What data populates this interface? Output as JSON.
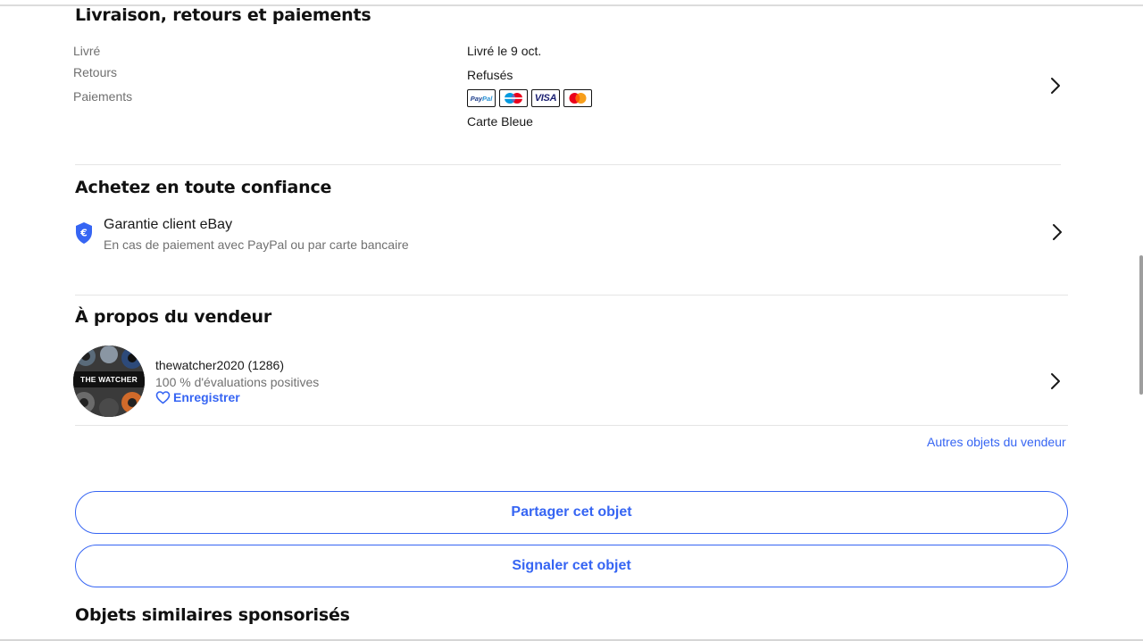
{
  "delivery_section": {
    "title": "Livraison, retours et paiements",
    "labels": {
      "delivered": "Livré",
      "returns": "Retours",
      "payments": "Paiements"
    },
    "values": {
      "delivered": "Livré le 9 oct.",
      "returns": "Refusés",
      "payment_note": "Carte Bleue"
    },
    "payment_methods": [
      {
        "name": "PayPal",
        "label_a": "Pay",
        "label_b": "Pal"
      },
      {
        "name": "Maestro",
        "label": "Maestro"
      },
      {
        "name": "Visa",
        "label": "VISA"
      },
      {
        "name": "Mastercard"
      }
    ]
  },
  "trust_section": {
    "title": "Achetez en toute confiance",
    "guarantee_title": "Garantie client eBay",
    "guarantee_subtitle": "En cas de paiement avec PayPal ou par carte bancaire"
  },
  "seller_section": {
    "title": "À propos du vendeur",
    "avatar_text": "THE WATCHER",
    "seller_name": "thewatcher2020 (1286)",
    "rating": "100 % d'évaluations positives",
    "save_label": "Enregistrer",
    "other_items_link": "Autres objets du vendeur"
  },
  "actions": {
    "share_label": "Partager cet objet",
    "report_label": "Signaler cet objet"
  },
  "sponsored_section": {
    "title": "Objets similaires sponsorisés"
  },
  "colors": {
    "accent": "#3665f3",
    "text": "#191919",
    "secondary_text": "#707070"
  },
  "icons": [
    "chevron-right-icon",
    "shield-euro-icon",
    "heart-icon"
  ]
}
